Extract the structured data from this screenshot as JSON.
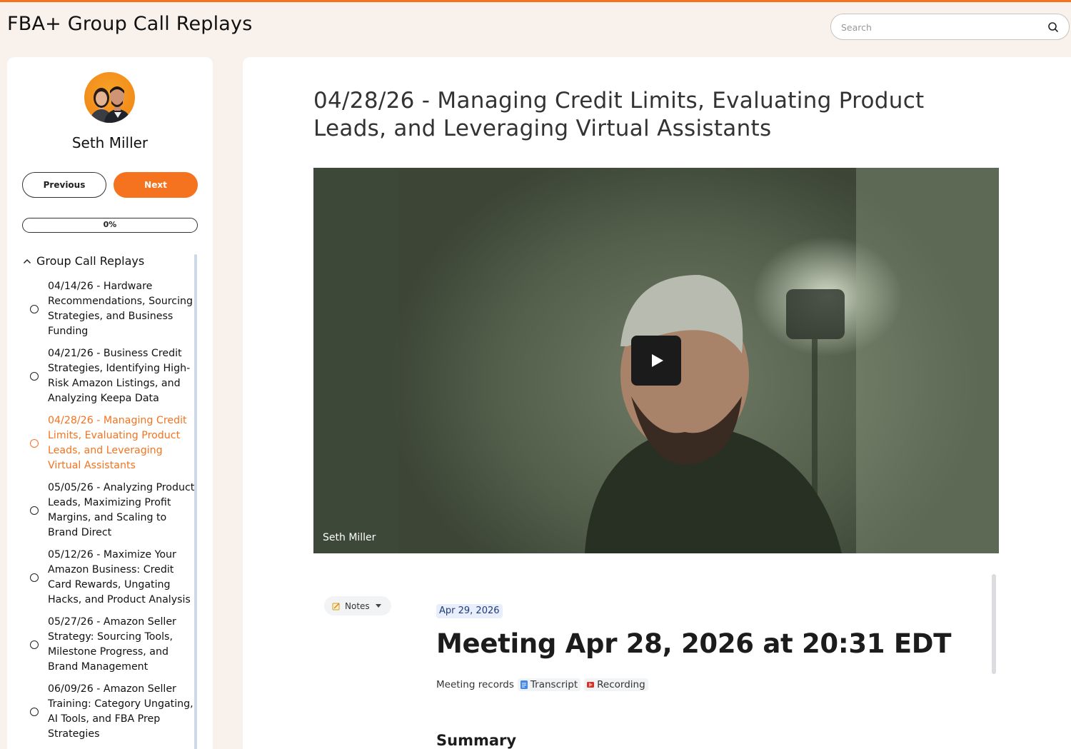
{
  "header": {
    "title": "FBA+ Group Call Replays",
    "search_placeholder": "Search"
  },
  "sidebar": {
    "author_name": "Seth Miller",
    "previous_label": "Previous",
    "next_label": "Next",
    "progress_label": "0%",
    "progress_value": 0,
    "section_title": "Group Call Replays",
    "lessons": [
      {
        "label": "04/14/26 - Hardware Recommendations, Sourcing Strategies, and Business Funding",
        "active": false
      },
      {
        "label": "04/21/26 - Business Credit Strategies, Identifying High-Risk Amazon Listings, and Analyzing Keepa Data",
        "active": false
      },
      {
        "label": "04/28/26 - Managing Credit Limits, Evaluating Product Leads, and Leveraging Virtual Assistants",
        "active": true
      },
      {
        "label": "05/05/26 - Analyzing Product Leads, Maximizing Profit Margins, and Scaling to Brand Direct",
        "active": false
      },
      {
        "label": "05/12/26 - Maximize Your Amazon Business: Credit Card Rewards, Ungating Hacks, and Product Analysis",
        "active": false
      },
      {
        "label": "05/27/26 - Amazon Seller Strategy: Sourcing Tools, Milestone Progress, and Brand Management",
        "active": false
      },
      {
        "label": "06/09/26 - Amazon Seller Training: Category Ungating, AI Tools, and FBA Prep Strategies",
        "active": false
      }
    ]
  },
  "main": {
    "lesson_title": "04/28/26 - Managing Credit Limits, Evaluating Product Leads, and Leveraging Virtual Assistants",
    "video_caption": "Seth Miller",
    "doc": {
      "notes_label": "Notes",
      "date_chip": "Apr 29, 2026",
      "heading": "Meeting Apr 28, 2026 at 20:31 EDT",
      "records_label": "Meeting records",
      "transcript_label": "Transcript",
      "recording_label": "Recording",
      "summary_heading": "Summary"
    }
  },
  "colors": {
    "accent": "#f5731f",
    "page_bg": "#f8f1ec"
  }
}
